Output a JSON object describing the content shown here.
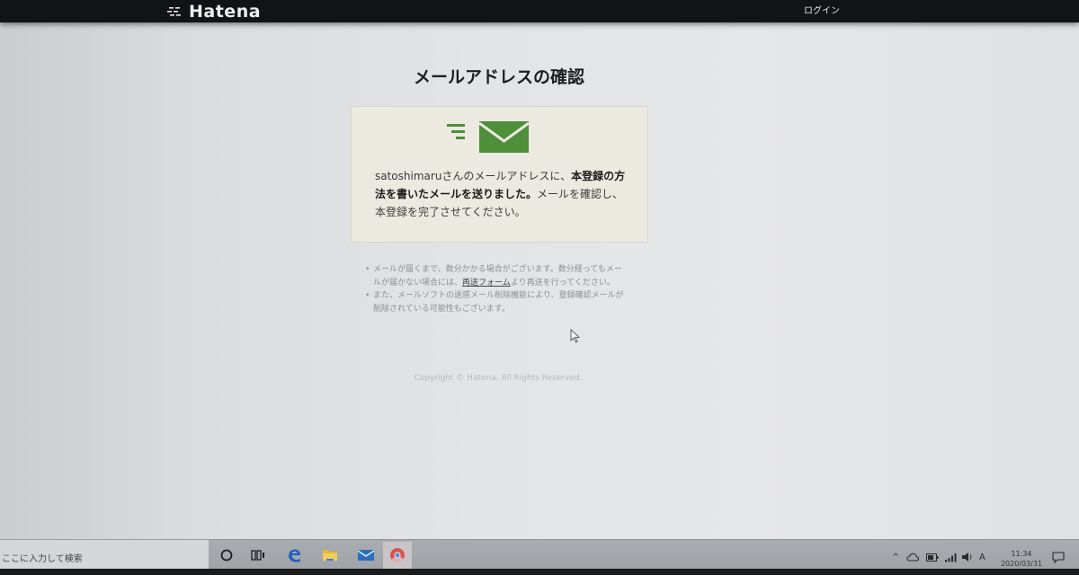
{
  "site": {
    "brand": "Hatena",
    "login_label": "ログイン"
  },
  "page": {
    "title": "メールアドレスの確認"
  },
  "message": {
    "part1": "satoshimaruさんのメールアドレスに、",
    "bold": "本登録の方法を書いたメールを送りました。",
    "part2": "メールを確認し、本登録を完了させてください。"
  },
  "notes": {
    "bullet": "•",
    "note1_before": "メールが届くまで、数分かかる場合がございます。数分経ってもメールが届かない場合には、",
    "note1_link": "再送フォーム",
    "note1_after": "より再送を行ってください。",
    "note2": "また、メールソフトの迷惑メール削除機能により、登録確認メールが削除されている可能性もございます。"
  },
  "footer": {
    "copyright": "Copyright © Hatena. All Rights Reserved."
  },
  "taskbar": {
    "search_placeholder": "ここに入力して検索",
    "clock_time": "11:34",
    "clock_date": "2020/03/31",
    "tray_chevron": "^",
    "tray_ime": "A"
  },
  "icons": {
    "brand": "hatena-logo-icon",
    "mail": "envelope-icon",
    "cortana": "cortana-icon",
    "task_view": "task-view-icon",
    "edge": "edge-icon",
    "explorer": "file-explorer-icon",
    "mail_app": "mail-app-icon",
    "chrome": "chrome-icon",
    "onedrive": "onedrive-icon",
    "battery": "battery-icon",
    "wifi": "wifi-icon",
    "volume": "volume-icon",
    "notification": "action-center-icon"
  },
  "colors": {
    "accent_green": "#4e8f3a",
    "topbar": "#121315",
    "card_bg": "#eceae0"
  }
}
